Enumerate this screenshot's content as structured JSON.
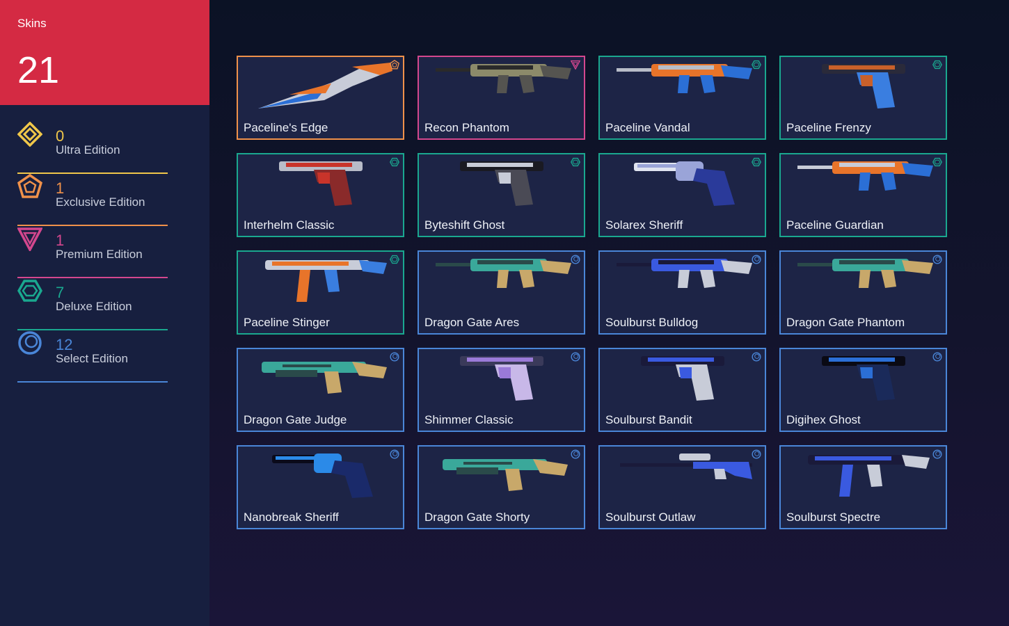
{
  "header": {
    "title": "Skins",
    "count": "21"
  },
  "colors": {
    "ultra": "#f0c74a",
    "exclusive": "#f0914a",
    "premium": "#d4478e",
    "deluxe": "#1aa88f",
    "select": "#4a86d8",
    "header_bg": "#d42a43"
  },
  "tiers": [
    {
      "key": "ultra",
      "count": "0",
      "label": "Ultra Edition",
      "icon": "ultra-edition-icon"
    },
    {
      "key": "exclusive",
      "count": "1",
      "label": "Exclusive Edition",
      "icon": "exclusive-edition-icon"
    },
    {
      "key": "premium",
      "count": "1",
      "label": "Premium Edition",
      "icon": "premium-edition-icon"
    },
    {
      "key": "deluxe",
      "count": "7",
      "label": "Deluxe Edition",
      "icon": "deluxe-edition-icon"
    },
    {
      "key": "select",
      "count": "12",
      "label": "Select Edition",
      "icon": "select-edition-icon"
    }
  ],
  "skins": [
    {
      "name": "Paceline's Edge",
      "tier": "exclusive",
      "weapon": "knife-icon",
      "palette": [
        "#e8742a",
        "#2b6fd6",
        "#c8ccd8"
      ]
    },
    {
      "name": "Recon Phantom",
      "tier": "premium",
      "weapon": "rifle-icon",
      "palette": [
        "#8c8a6a",
        "#555450",
        "#2a2a2a"
      ]
    },
    {
      "name": "Paceline Vandal",
      "tier": "deluxe",
      "weapon": "rifle-icon",
      "palette": [
        "#e8742a",
        "#2b6fd6",
        "#b8bcc8"
      ]
    },
    {
      "name": "Paceline Frenzy",
      "tier": "deluxe",
      "weapon": "pistol-icon",
      "palette": [
        "#c9602a",
        "#3a7ee0",
        "#2a2a3a"
      ]
    },
    {
      "name": "Interhelm Classic",
      "tier": "deluxe",
      "weapon": "pistol-icon",
      "palette": [
        "#c8342a",
        "#8a2a2a",
        "#b8bcc8"
      ]
    },
    {
      "name": "Byteshift Ghost",
      "tier": "deluxe",
      "weapon": "pistol-icon",
      "palette": [
        "#c8ccd8",
        "#4a4a55",
        "#1a1a22"
      ]
    },
    {
      "name": "Solarex Sheriff",
      "tier": "deluxe",
      "weapon": "revolver-icon",
      "palette": [
        "#9aa4d8",
        "#2a3a9a",
        "#e0e4f0"
      ]
    },
    {
      "name": "Paceline Guardian",
      "tier": "deluxe",
      "weapon": "rifle-icon",
      "palette": [
        "#e8742a",
        "#2b6fd6",
        "#c8ccd8"
      ]
    },
    {
      "name": "Paceline Stinger",
      "tier": "deluxe",
      "weapon": "smg-icon",
      "palette": [
        "#e8742a",
        "#3a7ee0",
        "#c8ccd8"
      ]
    },
    {
      "name": "Dragon Gate Ares",
      "tier": "select",
      "weapon": "rifle-icon",
      "palette": [
        "#3aa89a",
        "#c8a86a",
        "#2a4a4a"
      ]
    },
    {
      "name": "Soulburst Bulldog",
      "tier": "select",
      "weapon": "rifle-icon",
      "palette": [
        "#3a5ae0",
        "#c8ccd8",
        "#1a1a3a"
      ]
    },
    {
      "name": "Dragon Gate Phantom",
      "tier": "select",
      "weapon": "rifle-icon",
      "palette": [
        "#3aa89a",
        "#c8a86a",
        "#2a4a4a"
      ]
    },
    {
      "name": "Dragon Gate Judge",
      "tier": "select",
      "weapon": "shotgun-icon",
      "palette": [
        "#3aa89a",
        "#c8a86a",
        "#2a4a4a"
      ]
    },
    {
      "name": "Shimmer Classic",
      "tier": "select",
      "weapon": "pistol-icon",
      "palette": [
        "#9a7ad8",
        "#c8b8e8",
        "#3a3a5a"
      ]
    },
    {
      "name": "Soulburst Bandit",
      "tier": "select",
      "weapon": "pistol-icon",
      "palette": [
        "#3a5ae0",
        "#c8ccd8",
        "#1a1a3a"
      ]
    },
    {
      "name": "Digihex Ghost",
      "tier": "select",
      "weapon": "pistol-icon",
      "palette": [
        "#2b6fd6",
        "#1a2a5a",
        "#0a0a14"
      ]
    },
    {
      "name": "Nanobreak Sheriff",
      "tier": "select",
      "weapon": "revolver-icon",
      "palette": [
        "#2b8ae8",
        "#1a2a6a",
        "#0a0a1a"
      ]
    },
    {
      "name": "Dragon Gate Shorty",
      "tier": "select",
      "weapon": "shotgun-icon",
      "palette": [
        "#3aa89a",
        "#c8a86a",
        "#2a4a4a"
      ]
    },
    {
      "name": "Soulburst Outlaw",
      "tier": "select",
      "weapon": "sniper-icon",
      "palette": [
        "#3a5ae0",
        "#c8ccd8",
        "#1a1a3a"
      ]
    },
    {
      "name": "Soulburst Spectre",
      "tier": "select",
      "weapon": "smg-icon",
      "palette": [
        "#3a5ae0",
        "#c8ccd8",
        "#1a1a3a"
      ]
    }
  ]
}
